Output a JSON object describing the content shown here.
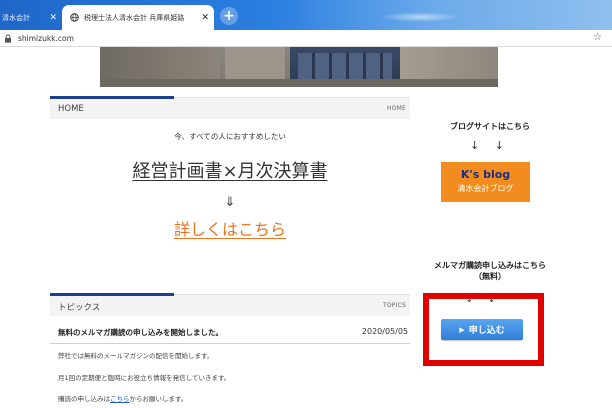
{
  "browser": {
    "tabs": [
      {
        "title": "清水会計",
        "active": false
      },
      {
        "title": "税理士法人清水会計  兵庫県姫路",
        "active": true
      }
    ],
    "new_tab_label": "+",
    "close_glyph": "✕",
    "url": "shimizukk.com",
    "bookmark_glyph": "☆"
  },
  "home": {
    "title": "HOME",
    "badge": "HOME",
    "intro": "今、すべての人におすすめしたい",
    "headline": "経営計画書×月次決算書",
    "arrow": "⇓",
    "details_link": "詳しくはこちら"
  },
  "topics": {
    "title": "トピックス",
    "badge": "TOPICS",
    "items": [
      {
        "title": "無料のメルマガ購読の申し込みを開始しました。",
        "date": "2020/05/05"
      }
    ],
    "body_lines": [
      "弊社では無料のメールマガジンの配信を開始します。",
      "月1回の定期便と臨時にお役立ち情報を発信していきます。"
    ],
    "apply_prefix": "購読の申し込みは",
    "apply_link": "こちら",
    "apply_suffix": "からお願いします。"
  },
  "sidebar": {
    "blog_heading": "ブログサイトはこちら",
    "arrows": "↓ ↓",
    "blog_name": "K's blog",
    "blog_sub": "清水会計ブログ",
    "mail_heading_1": "メルマガ購読申し込みはこちら",
    "mail_heading_2": "（無料）",
    "mail_arrows": "↓ ↓",
    "signup_label": "申し込む"
  },
  "colors": {
    "accent_orange": "#e8731f",
    "blog_orange": "#f28c1e",
    "navy": "#1d3f8f",
    "highlight_red": "#e10000",
    "button_blue": "#2f7fd8"
  },
  "icons": {
    "tab_favicon": "globe-icon",
    "address_lock": "lock-icon",
    "bookmark": "star-icon",
    "signup_play": "play-icon"
  }
}
